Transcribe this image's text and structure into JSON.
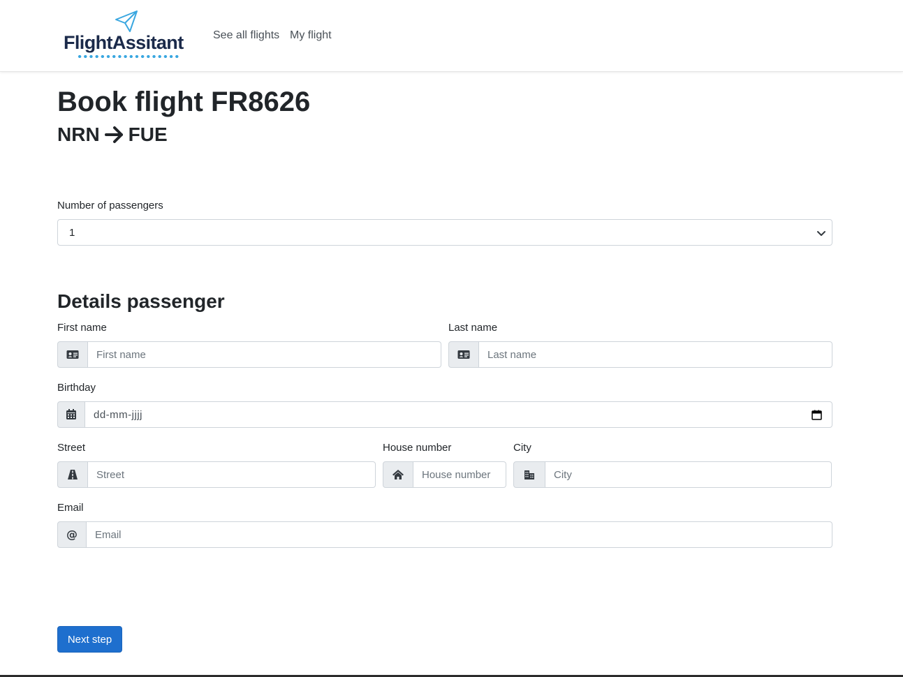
{
  "brand": {
    "name": "FlightAssitant"
  },
  "nav": {
    "see_all_flights": "See all flights",
    "my_flight": "My flight"
  },
  "page": {
    "title": "Book flight FR8626",
    "route": {
      "from": "NRN",
      "to": "FUE"
    }
  },
  "passengers": {
    "label": "Number of passengers",
    "selected": "1"
  },
  "details": {
    "title": "Details passenger",
    "first_name": {
      "label": "First name",
      "placeholder": "First name"
    },
    "last_name": {
      "label": "Last name",
      "placeholder": "Last name"
    },
    "birthday": {
      "label": "Birthday",
      "placeholder": "dd-mm-jjjj"
    },
    "street": {
      "label": "Street",
      "placeholder": "Street"
    },
    "house_number": {
      "label": "House number",
      "placeholder": "House number"
    },
    "city": {
      "label": "City",
      "placeholder": "City"
    },
    "email": {
      "label": "Email",
      "placeholder": "Email"
    }
  },
  "actions": {
    "next_step": "Next step"
  },
  "icons": {
    "logo": "paper-plane-icon",
    "first_name": "id-card-icon",
    "last_name": "id-card-icon",
    "birthday": "calendar-icon",
    "street": "road-icon",
    "house_number": "home-icon",
    "city": "city-icon",
    "email": "at-icon",
    "select": "chevron-down-icon"
  },
  "colors": {
    "primary": "#1e6fce",
    "brand_text": "#1b2a4a",
    "brand_accent": "#3aa7e0"
  }
}
